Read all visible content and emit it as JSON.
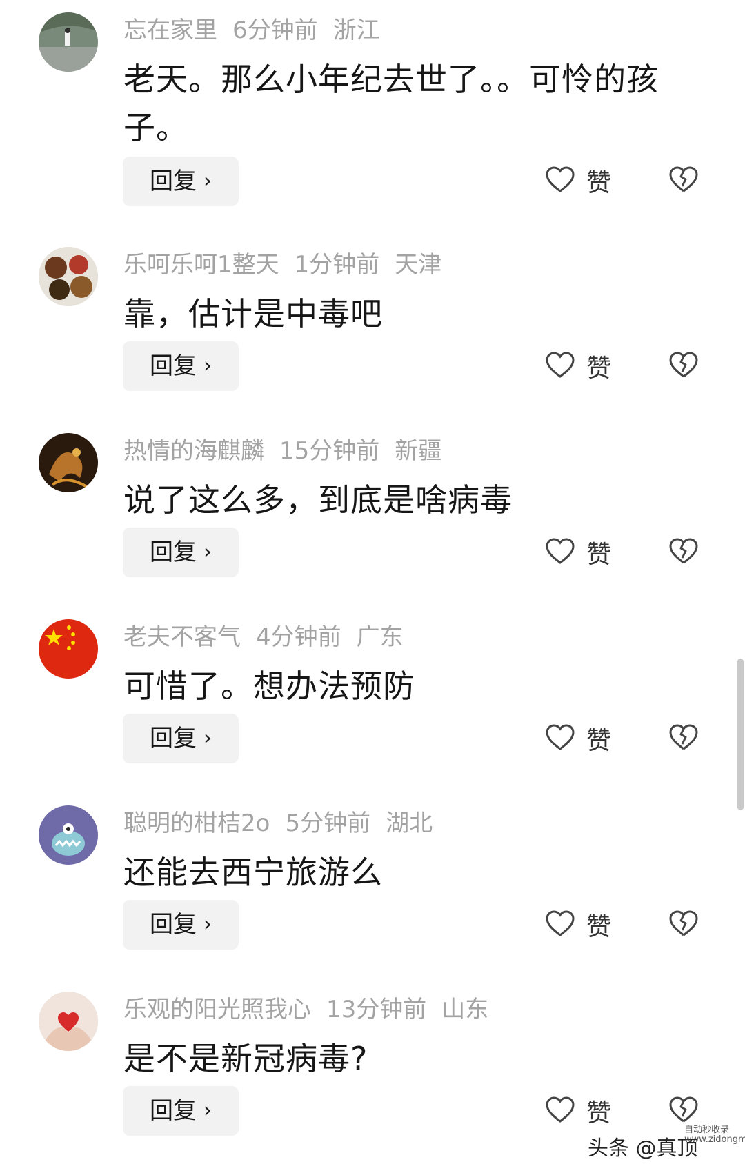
{
  "comments": [
    {
      "user": "忘在家里",
      "time": "6分钟前",
      "region": "浙江",
      "text": "老天。那么小年纪去世了。。可怜的孩子。",
      "reply": "回复",
      "like": "赞"
    },
    {
      "user": "乐呵乐呵1整天",
      "time": "1分钟前",
      "region": "天津",
      "text": "靠，估计是中毒吧",
      "reply": "回复",
      "like": "赞"
    },
    {
      "user": "热情的海麒麟",
      "time": "15分钟前",
      "region": "新疆",
      "text": "说了这么多，到底是啥病毒",
      "reply": "回复",
      "like": "赞"
    },
    {
      "user": "老夫不客气",
      "time": "4分钟前",
      "region": "广东",
      "text": "可惜了。想办法预防",
      "reply": "回复",
      "like": "赞"
    },
    {
      "user": "聪明的柑桔2o",
      "time": "5分钟前",
      "region": "湖北",
      "text": "还能去西宁旅游么",
      "reply": "回复",
      "like": "赞"
    },
    {
      "user": "乐观的阳光照我心",
      "time": "13分钟前",
      "region": "山东",
      "text": "是不是新冠病毒?",
      "reply": "回复",
      "like": "赞"
    }
  ],
  "watermark": {
    "text": "头条 @真顶",
    "overlay_line1": "自动秒收录",
    "overlay_line2": "www.zidongmiao..."
  },
  "colors": {
    "meta": "#a3a3a3",
    "text": "#161616",
    "reply_bg": "#f2f2f2"
  }
}
